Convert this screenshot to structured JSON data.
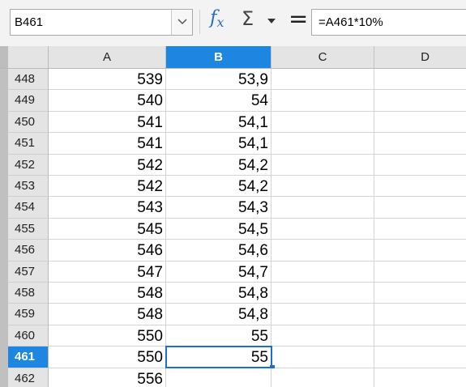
{
  "formula_bar": {
    "name_box": "B461",
    "fx_icon": "function-wizard-icon",
    "sigma_icon": "sum-icon",
    "equals_icon": "formula-icon",
    "formula": "=A461*10%"
  },
  "columns": [
    "A",
    "B",
    "C",
    "D"
  ],
  "selected_column": "B",
  "active_cell": "B461",
  "rows": [
    {
      "num": "448",
      "a": "539",
      "b": "53,9"
    },
    {
      "num": "449",
      "a": "540",
      "b": "54"
    },
    {
      "num": "450",
      "a": "541",
      "b": "54,1"
    },
    {
      "num": "451",
      "a": "541",
      "b": "54,1"
    },
    {
      "num": "452",
      "a": "542",
      "b": "54,2"
    },
    {
      "num": "453",
      "a": "542",
      "b": "54,2"
    },
    {
      "num": "454",
      "a": "543",
      "b": "54,3"
    },
    {
      "num": "455",
      "a": "545",
      "b": "54,5"
    },
    {
      "num": "456",
      "a": "546",
      "b": "54,6"
    },
    {
      "num": "457",
      "a": "547",
      "b": "54,7"
    },
    {
      "num": "458",
      "a": "548",
      "b": "54,8"
    },
    {
      "num": "459",
      "a": "548",
      "b": "54,8"
    },
    {
      "num": "460",
      "a": "550",
      "b": "55"
    },
    {
      "num": "461",
      "a": "550",
      "b": "55"
    },
    {
      "num": "462",
      "a": "556",
      "b": ""
    }
  ],
  "colors": {
    "selection_header": "#1c86e0",
    "active_border": "#1c6fd0",
    "fx_icon": "#2a6fc0"
  }
}
